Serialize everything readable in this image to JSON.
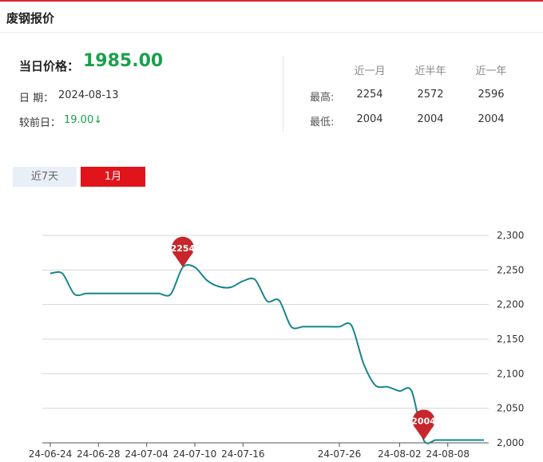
{
  "header": {
    "title": "废钢报价"
  },
  "summary": {
    "price_label": "当日价格：",
    "price_value": "1985.00",
    "date_label": "日  期：",
    "date_value": "2024-08-13",
    "change_label": "较前日：",
    "change_value": "19.00↓"
  },
  "stats": {
    "columns": [
      "近一月",
      "近半年",
      "近一年"
    ],
    "rows": [
      {
        "label": "最高:",
        "values": [
          "2254",
          "2572",
          "2596"
        ]
      },
      {
        "label": "最低:",
        "values": [
          "2004",
          "2004",
          "2004"
        ]
      }
    ]
  },
  "tabs": [
    {
      "label": "近7天",
      "active": false
    },
    {
      "label": "1月",
      "active": true
    }
  ],
  "colors": {
    "line": "#16868c",
    "pin": "#c7262c",
    "accent": "#e0141a",
    "up_down": "#19a04b"
  },
  "chart_data": {
    "type": "line",
    "title": "",
    "xlabel": "",
    "ylabel": "",
    "ylim": [
      2000,
      2300
    ],
    "yticks": [
      2000,
      2050,
      2100,
      2150,
      2200,
      2250,
      2300
    ],
    "ytick_labels": [
      "2,000",
      "2,050",
      "2,100",
      "2,150",
      "2,200",
      "2,250",
      "2,300"
    ],
    "xtick_labels": [
      "24-06-24",
      "24-06-28",
      "24-07-04",
      "24-07-10",
      "24-07-16",
      "24-07-26",
      "24-08-02",
      "24-08-08"
    ],
    "grid": true,
    "x": [
      "24-06-24",
      "24-06-25",
      "24-06-26",
      "24-06-27",
      "24-06-28",
      "24-07-01",
      "24-07-02",
      "24-07-03",
      "24-07-04",
      "24-07-05",
      "24-07-08",
      "24-07-09",
      "24-07-10",
      "24-07-11",
      "24-07-12",
      "24-07-15",
      "24-07-16",
      "24-07-17",
      "24-07-18",
      "24-07-19",
      "24-07-22",
      "24-07-23",
      "24-07-24",
      "24-07-25",
      "24-07-26",
      "24-07-29",
      "24-07-30",
      "24-07-31",
      "24-08-01",
      "24-08-02",
      "24-08-05",
      "24-08-06",
      "24-08-07",
      "24-08-08",
      "24-08-09",
      "24-08-12",
      "24-08-13"
    ],
    "series": [
      {
        "values": [
          2245,
          2245,
          2215,
          2216,
          2216,
          2216,
          2216,
          2216,
          2216,
          2216,
          2215,
          2254,
          2254,
          2235,
          2226,
          2225,
          2234,
          2236,
          2205,
          2206,
          2168,
          2168,
          2168,
          2168,
          2168,
          2170,
          2115,
          2083,
          2081,
          2075,
          2075,
          2004,
          2004,
          2004,
          2004,
          2004,
          2004
        ]
      }
    ],
    "annotations": [
      {
        "label": "2254",
        "x": "24-07-09",
        "value": 2254
      },
      {
        "label": "2004",
        "x": "24-08-06",
        "value": 2004
      }
    ]
  }
}
